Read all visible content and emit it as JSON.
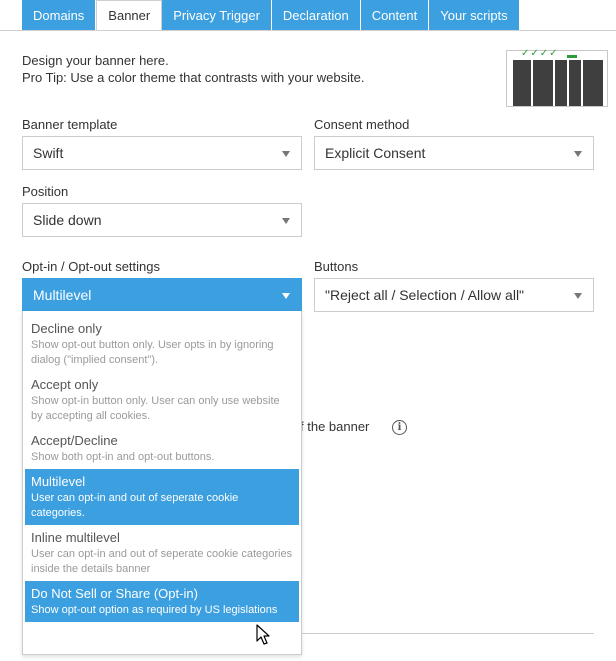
{
  "tabs": [
    {
      "label": "Domains",
      "active": false
    },
    {
      "label": "Banner",
      "active": true
    },
    {
      "label": "Privacy Trigger",
      "active": false
    },
    {
      "label": "Declaration",
      "active": false
    },
    {
      "label": "Content",
      "active": false
    },
    {
      "label": "Your scripts",
      "active": false
    }
  ],
  "intro": {
    "line1": "Design your banner here.",
    "line2": "Pro Tip: Use a color theme that contrasts with your website."
  },
  "preview": {
    "ticks": "✓✓✓✓"
  },
  "fields": {
    "banner_template": {
      "label": "Banner template",
      "value": "Swift"
    },
    "consent_method": {
      "label": "Consent method",
      "value": "Explicit Consent"
    },
    "position": {
      "label": "Position",
      "value": "Slide down"
    },
    "optin": {
      "label": "Opt-in / Opt-out settings",
      "value": "Multilevel"
    },
    "buttons": {
      "label": "Buttons",
      "value": "\"Reject all / Selection / Allow all\""
    }
  },
  "behind": {
    "text": "f the banner",
    "info_glyph": "i"
  },
  "dropdown": {
    "options": [
      {
        "title": "Decline only",
        "desc": "Show opt-out button only. User opts in by ignoring dialog (\"implied consent\").",
        "selected": false
      },
      {
        "title": "Accept only",
        "desc": "Show opt-in button only. User can only use website by accepting all cookies.",
        "selected": false
      },
      {
        "title": "Accept/Decline",
        "desc": "Show both opt-in and opt-out buttons.",
        "selected": false
      },
      {
        "title": "Multilevel",
        "desc": "User can opt-in and out of seperate cookie categories.",
        "selected": true
      },
      {
        "title": "Inline multilevel",
        "desc": "User can opt-in and out of seperate cookie categories inside the details banner",
        "selected": false
      },
      {
        "title": "Do Not Sell or Share (Opt-in)",
        "desc": "Show opt-out option as required by US legislations",
        "selected": true
      }
    ]
  },
  "colors": {
    "accent": "#3b9fe0",
    "preview_dark": "#3f3f3f",
    "preview_check": "#2d9a3a"
  }
}
